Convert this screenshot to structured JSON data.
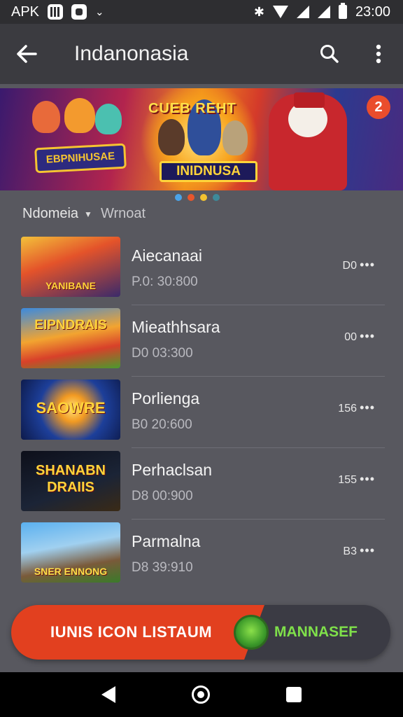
{
  "status_bar": {
    "carrier": "APK",
    "time": "23:00"
  },
  "app_bar": {
    "title": "Indanonasia",
    "back_icon": "arrow-back-icon",
    "search_icon": "search-icon",
    "menu_icon": "more-vert-icon"
  },
  "banner": {
    "left_label": "EBPNIHUSAE",
    "top_label": "CUEB REHT",
    "mid_label": "INIDNUSA",
    "badge": "2",
    "dot_colors": [
      "#4aa3e8",
      "#e8562c",
      "#f2c230",
      "#3d8a9a"
    ]
  },
  "filter": {
    "primary": "Ndomeia",
    "secondary": "Wrnoat"
  },
  "games": [
    {
      "title": "Aiecanaai",
      "subtitle": "P.0: 30:800",
      "meta": "D0",
      "thumb_label": "YANIBANE"
    },
    {
      "title": "Mieathhsara",
      "subtitle": "D0 03:300",
      "meta": "00",
      "thumb_label": "EIPNDRAIS"
    },
    {
      "title": "Porliengа",
      "subtitle": "B0 20:600",
      "meta": "156",
      "thumb_label": "SAOWRE"
    },
    {
      "title": "Perhaclsan",
      "subtitle": "D8 00:900",
      "meta": "155",
      "thumb_label": "SHANABN DRAIIS"
    },
    {
      "title": "Parmalna",
      "subtitle": "D8 39:910",
      "meta": "B3",
      "thumb_label": "SNER ENNONG"
    }
  ],
  "cta": {
    "left_label": "IUNIS ICON LISTAUM",
    "right_label": "MANNASEF"
  },
  "colors": {
    "background": "#58585f",
    "app_bar": "#3b3b40",
    "cta_orange": "#e2401f",
    "cta_green": "#7fe04a"
  }
}
